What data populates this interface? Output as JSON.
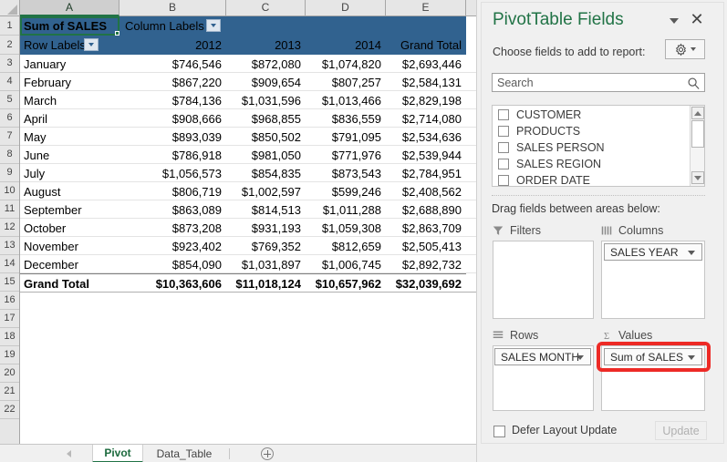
{
  "spreadsheet": {
    "column_headers": [
      "A",
      "B",
      "C",
      "D",
      "E"
    ],
    "selected_column": "A",
    "row_numbers": [
      "1",
      "2",
      "3",
      "4",
      "5",
      "6",
      "7",
      "8",
      "9",
      "10",
      "11",
      "12",
      "13",
      "14",
      "15",
      "16",
      "17",
      "18",
      "19",
      "20",
      "21",
      "22"
    ],
    "value_header": "Sum of SALES",
    "column_labels_header": "Column Labels",
    "row_labels_header": "Row Labels",
    "column_headers_data": [
      "2012",
      "2013",
      "2014",
      "Grand Total"
    ],
    "rows": [
      {
        "label": "January",
        "values": [
          "$746,546",
          "$872,080",
          "$1,074,820",
          "$2,693,446"
        ]
      },
      {
        "label": "February",
        "values": [
          "$867,220",
          "$909,654",
          "$807,257",
          "$2,584,131"
        ]
      },
      {
        "label": "March",
        "values": [
          "$784,136",
          "$1,031,596",
          "$1,013,466",
          "$2,829,198"
        ]
      },
      {
        "label": "April",
        "values": [
          "$908,666",
          "$968,855",
          "$836,559",
          "$2,714,080"
        ]
      },
      {
        "label": "May",
        "values": [
          "$893,039",
          "$850,502",
          "$791,095",
          "$2,534,636"
        ]
      },
      {
        "label": "June",
        "values": [
          "$786,918",
          "$981,050",
          "$771,976",
          "$2,539,944"
        ]
      },
      {
        "label": "July",
        "values": [
          "$1,056,573",
          "$854,835",
          "$873,543",
          "$2,784,951"
        ]
      },
      {
        "label": "August",
        "values": [
          "$806,719",
          "$1,002,597",
          "$599,246",
          "$2,408,562"
        ]
      },
      {
        "label": "September",
        "values": [
          "$863,089",
          "$814,513",
          "$1,011,288",
          "$2,688,890"
        ]
      },
      {
        "label": "October",
        "values": [
          "$873,208",
          "$931,193",
          "$1,059,308",
          "$2,863,709"
        ]
      },
      {
        "label": "November",
        "values": [
          "$923,402",
          "$769,352",
          "$812,659",
          "$2,505,413"
        ]
      },
      {
        "label": "December",
        "values": [
          "$854,090",
          "$1,031,897",
          "$1,006,745",
          "$2,892,732"
        ]
      }
    ],
    "grand_total": {
      "label": "Grand Total",
      "values": [
        "$10,363,606",
        "$11,018,124",
        "$10,657,962",
        "$32,039,692"
      ]
    }
  },
  "tabbar": {
    "tabs": [
      {
        "label": "Pivot",
        "active": true
      },
      {
        "label": "Data_Table",
        "active": false
      }
    ],
    "add_sheet_icon": "plus-circle-icon",
    "prev_icon": "triangle-left-icon",
    "next_icon": "triangle-right-icon"
  },
  "panel": {
    "title": "PivotTable Fields",
    "collapse_icon": "chevron-down-icon",
    "close_icon": "close-icon",
    "choose_label": "Choose fields to add to report:",
    "gear_icon": "gear-icon",
    "gear_caret_icon": "chevron-down-icon",
    "search": {
      "placeholder": "Search",
      "value": "Search",
      "icon": "search-icon"
    },
    "fields": [
      {
        "label": "CUSTOMER",
        "checked": false
      },
      {
        "label": "PRODUCTS",
        "checked": false
      },
      {
        "label": "SALES PERSON",
        "checked": false
      },
      {
        "label": "SALES REGION",
        "checked": false
      },
      {
        "label": "ORDER DATE",
        "checked": false
      }
    ],
    "scrollbar": {
      "up_icon": "triangle-up-icon",
      "down_icon": "triangle-down-icon"
    },
    "drag_label": "Drag fields between areas below:",
    "areas": {
      "filters": {
        "title": "Filters",
        "icon": "filter-icon",
        "items": []
      },
      "columns": {
        "title": "Columns",
        "icon": "columns-icon",
        "items": [
          "SALES YEAR"
        ]
      },
      "rows": {
        "title": "Rows",
        "icon": "rows-icon",
        "items": [
          "SALES MONTH"
        ]
      },
      "values": {
        "title": "Values",
        "icon": "sigma-icon",
        "items": [
          "Sum of SALES"
        ],
        "highlighted": true
      }
    },
    "defer_label": "Defer Layout Update",
    "defer_checked": false,
    "update_label": "Update",
    "update_disabled": true
  },
  "colors": {
    "pivot_header_blue": "#31628f",
    "excel_green": "#217346",
    "highlight_red": "#ed2a26",
    "panel_bg": "#f0f0f0"
  }
}
